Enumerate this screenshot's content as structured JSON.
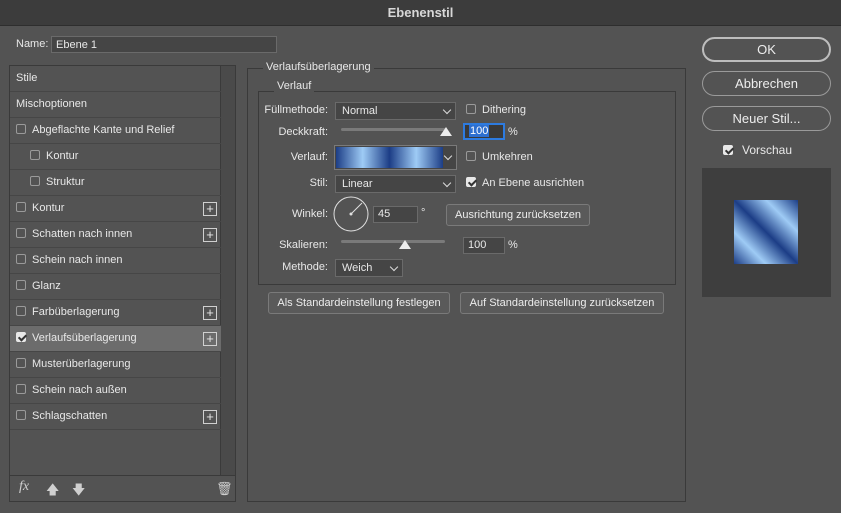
{
  "window": {
    "title": "Ebenenstil"
  },
  "name_field": {
    "label": "Name:",
    "value": "Ebene 1"
  },
  "style_list": {
    "items": [
      {
        "label": "Stile",
        "checkbox": false,
        "checked": false,
        "indent": 0,
        "plus": false,
        "selected": false
      },
      {
        "label": "Mischoptionen",
        "checkbox": false,
        "checked": false,
        "indent": 0,
        "plus": false,
        "selected": false
      },
      {
        "label": "Abgeflachte Kante und Relief",
        "checkbox": true,
        "checked": false,
        "indent": 0,
        "plus": false,
        "selected": false
      },
      {
        "label": "Kontur",
        "checkbox": true,
        "checked": false,
        "indent": 1,
        "plus": false,
        "selected": false
      },
      {
        "label": "Struktur",
        "checkbox": true,
        "checked": false,
        "indent": 1,
        "plus": false,
        "selected": false
      },
      {
        "label": "Kontur",
        "checkbox": true,
        "checked": false,
        "indent": 0,
        "plus": true,
        "selected": false
      },
      {
        "label": "Schatten nach innen",
        "checkbox": true,
        "checked": false,
        "indent": 0,
        "plus": true,
        "selected": false
      },
      {
        "label": "Schein nach innen",
        "checkbox": true,
        "checked": false,
        "indent": 0,
        "plus": false,
        "selected": false
      },
      {
        "label": "Glanz",
        "checkbox": true,
        "checked": false,
        "indent": 0,
        "plus": false,
        "selected": false
      },
      {
        "label": "Farbüberlagerung",
        "checkbox": true,
        "checked": false,
        "indent": 0,
        "plus": true,
        "selected": false
      },
      {
        "label": "Verlaufsüberlagerung",
        "checkbox": true,
        "checked": true,
        "indent": 0,
        "plus": true,
        "selected": true
      },
      {
        "label": "Musterüberlagerung",
        "checkbox": true,
        "checked": false,
        "indent": 0,
        "plus": false,
        "selected": false
      },
      {
        "label": "Schein nach außen",
        "checkbox": true,
        "checked": false,
        "indent": 0,
        "plus": false,
        "selected": false
      },
      {
        "label": "Schlagschatten",
        "checkbox": true,
        "checked": false,
        "indent": 0,
        "plus": true,
        "selected": false
      }
    ],
    "footer": {
      "fx_label": "fx",
      "up_icon": "arrow-up-icon",
      "down_icon": "arrow-down-icon",
      "trash_icon": "trash-icon"
    }
  },
  "panel": {
    "group_title": "Verlaufsüberlagerung",
    "subgroup_title": "Verlauf",
    "fuellmethode": {
      "label": "Füllmethode:",
      "value": "Normal"
    },
    "dithering": {
      "label": "Dithering",
      "checked": false
    },
    "deckkraft": {
      "label": "Deckkraft:",
      "value": "100",
      "unit": "%",
      "level": 1.0
    },
    "verlauf": {
      "label": "Verlauf:",
      "colors": [
        "#1c3d86",
        "#9ecbf5"
      ]
    },
    "umkehren": {
      "label": "Umkehren",
      "checked": false
    },
    "stil": {
      "label": "Stil:",
      "value": "Linear"
    },
    "an_ebene": {
      "label": "An Ebene ausrichten",
      "checked": true
    },
    "winkel": {
      "label": "Winkel:",
      "value": "45",
      "unit": "°"
    },
    "reset_align_button": "Ausrichtung zurücksetzen",
    "skalieren": {
      "label": "Skalieren:",
      "value": "100",
      "unit": "%",
      "level": 0.66
    },
    "methode": {
      "label": "Methode:",
      "value": "Weich"
    },
    "set_default_button": "Als Standardeinstellung festlegen",
    "reset_default_button": "Auf Standardeinstellung zurücksetzen"
  },
  "actions": {
    "ok": "OK",
    "cancel": "Abbrechen",
    "new_style": "Neuer Stil...",
    "preview": {
      "label": "Vorschau",
      "checked": true
    }
  }
}
